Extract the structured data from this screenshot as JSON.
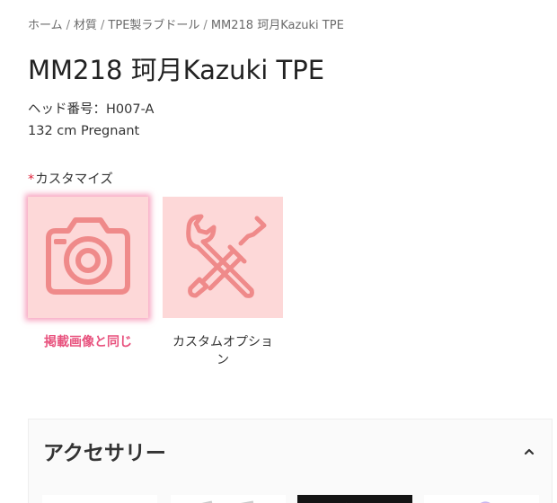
{
  "breadcrumb": {
    "home": "ホーム",
    "material": "材質",
    "category": "TPE製ラブドール",
    "current": "MM218 珂月Kazuki TPE",
    "separator": "/"
  },
  "product": {
    "title": "MM218 珂月Kazuki TPE",
    "head_number": "ヘッド番号：H007-A",
    "size": "132 cm Pregnant"
  },
  "customize": {
    "required_mark": "*",
    "label": "カスタマイズ",
    "options": [
      {
        "label": "掲載画像と同じ",
        "icon": "camera-icon",
        "selected": true
      },
      {
        "label": "カスタムオプション",
        "icon": "wrench-screwdriver-icon",
        "selected": false
      }
    ]
  },
  "accessory": {
    "title": "アクセサリー",
    "expanded": true
  },
  "colors": {
    "option_bg": "#fdd8d8",
    "icon_stroke": "#ef8a8a",
    "selected_caption": "#e8527e",
    "selected_glow": "#f05a8c"
  }
}
